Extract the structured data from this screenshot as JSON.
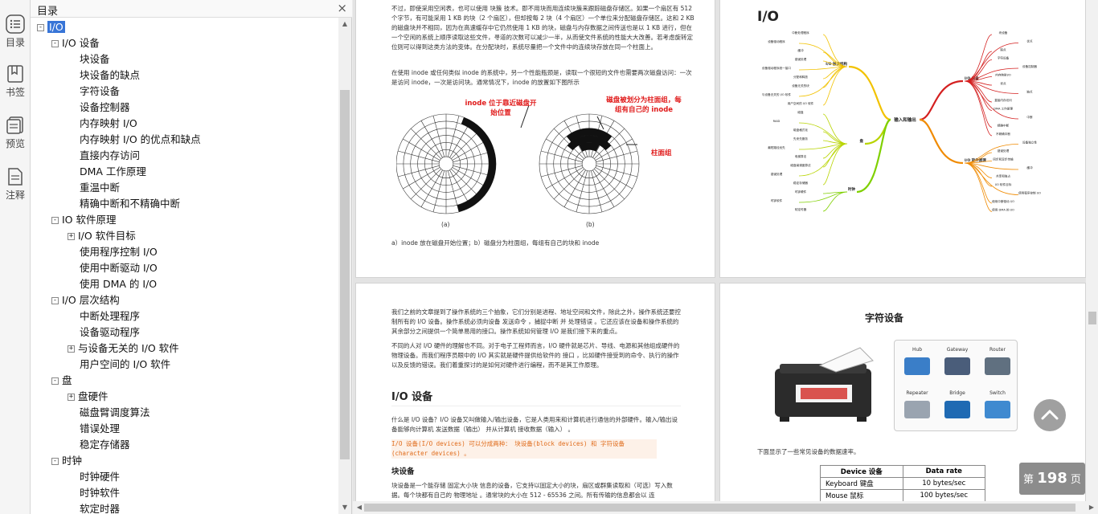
{
  "rail": [
    {
      "label": "目录",
      "icon": "list-icon"
    },
    {
      "label": "书签",
      "icon": "bookmark-icon"
    },
    {
      "label": "预览",
      "icon": "preview-icon"
    },
    {
      "label": "注释",
      "icon": "note-icon"
    }
  ],
  "toc": {
    "title": "目录",
    "close": "×",
    "items": [
      {
        "label": "I/O",
        "level": 0,
        "toggle": "-",
        "selected": true
      },
      {
        "label": "I/O 设备",
        "level": 1,
        "toggle": "-"
      },
      {
        "label": "块设备",
        "level": 2
      },
      {
        "label": "块设备的缺点",
        "level": 2
      },
      {
        "label": "字符设备",
        "level": 2
      },
      {
        "label": "设备控制器",
        "level": 2
      },
      {
        "label": "内存映射 I/O",
        "level": 2
      },
      {
        "label": "内存映射 I/O 的优点和缺点",
        "level": 2
      },
      {
        "label": "直接内存访问",
        "level": 2
      },
      {
        "label": "DMA 工作原理",
        "level": 2
      },
      {
        "label": "重温中断",
        "level": 2
      },
      {
        "label": "精确中断和不精确中断",
        "level": 2
      },
      {
        "label": "IO 软件原理",
        "level": 1,
        "toggle": "-"
      },
      {
        "label": "I/O 软件目标",
        "level": 2,
        "toggle": "+"
      },
      {
        "label": "使用程序控制 I/O",
        "level": 2
      },
      {
        "label": "使用中断驱动 I/O",
        "level": 2
      },
      {
        "label": "使用 DMA 的 I/O",
        "level": 2
      },
      {
        "label": "I/O 层次结构",
        "level": 1,
        "toggle": "-"
      },
      {
        "label": "中断处理程序",
        "level": 2
      },
      {
        "label": "设备驱动程序",
        "level": 2
      },
      {
        "label": "与设备无关的 I/O 软件",
        "level": 2,
        "toggle": "+"
      },
      {
        "label": "用户空间的 I/O 软件",
        "level": 2
      },
      {
        "label": "盘",
        "level": 1,
        "toggle": "-"
      },
      {
        "label": "盘硬件",
        "level": 2,
        "toggle": "+"
      },
      {
        "label": "磁盘臂调度算法",
        "level": 2
      },
      {
        "label": "错误处理",
        "level": 2
      },
      {
        "label": "稳定存储器",
        "level": 2
      },
      {
        "label": "时钟",
        "level": 1,
        "toggle": "-"
      },
      {
        "label": "时钟硬件",
        "level": 2
      },
      {
        "label": "时钟软件",
        "level": 2
      },
      {
        "label": "软定时器",
        "level": 2
      }
    ]
  },
  "page1": {
    "para1": "不过，即使采用空闲表，也可以使用 块簇 技术。即不用块而用连续块簇来跟踪磁盘存储区。如果一个扇区有 512 个字节，有可能采用 1 KB 的块（2 个扇区），但却按每 2 块（4 个扇区）一个单位来分配磁盘存储区。这和 2 KB 的磁盘块并不相同，因为在高速缓存中它仍然使用 1 KB 的块，磁盘与内存数据之间传送也是以 1 KB 进行，但在一个空闲的系统上顺序读取这些文件，寻道的次数可以减少一半，从而使文件系统的性能大大改善。若考虑旋转定位则可以得到这类方法的变体。在分配块时，系统尽量把一个文件中的连续块存放在同一个柱面上。",
    "para2": "在使用 inode 或任何类似 inode 的系统中，另一个性能瓶颈是，读取一个很短的文件也需要两次磁盘访问：一次是访问 inode，一次是访问块。通常情况下，inode 的放置如下图所示",
    "fig_label_a_title": "inode 位于靠近磁盘开始位置",
    "fig_label_b_title": "磁盘被划分为柱面组，每组有自己的 inode",
    "fig_label_cyl": "柱面组",
    "fig_a": "(a)",
    "fig_b": "(b)",
    "caption": "a）inode 放在磁盘开始位置；b）磁盘分为柱面组，每组有自己的块和 inode"
  },
  "page2": {
    "title": "I/O",
    "root": "输入和输出",
    "branches": [
      {
        "name": "I/O 层次结构",
        "color": "#f2c200"
      },
      {
        "name": "盘",
        "color": "#b8d400"
      },
      {
        "name": "时钟",
        "color": "#7fd000"
      },
      {
        "name": "I/O 设备",
        "color": "#d42020"
      },
      {
        "name": "I/O 软件原理",
        "color": "#f08a00"
      }
    ],
    "leaves_left": [
      "中断处理程序",
      "设备驱动程序",
      "缓冲",
      "错误处理",
      "设备驱动程序统一接口",
      "分配和释放",
      "设备无关的块",
      "与设备无关的 I/O 软件",
      "用户空间的 I/O 软件",
      "磁盘",
      "RAID",
      "磁盘格式化",
      "先来先服务",
      "最短路径优先",
      "电梯算法",
      "磁盘臂调度算法",
      "错误处理",
      "稳定存储器",
      "时钟硬件",
      "时钟软件",
      "软定时器"
    ],
    "leaves_right": [
      "块设备",
      "优点",
      "缺点",
      "字符设备",
      "设备控制器",
      "内存映射I/O",
      "优点",
      "缺点",
      "直接内存访问",
      "DMA 工作原理",
      "中断",
      "精确中断",
      "不精确中断",
      "设备独立性",
      "错误处理",
      "同步和异步传输",
      "缓冲",
      "共享和独占",
      "I/O 软件目标",
      "使用程序控制 I/O",
      "使用中断驱动 I/O",
      "使用 DMA 的 I/O"
    ]
  },
  "page3": {
    "para1": "我们之前的文章提到了操作系统的三个抽象，它们分别是进程、地址空间和文件，除此之外，操作系统还要控制所有的 I/O 设备。操作系统必须向设备 发送命令 ，捕捉中断 并 处理错误 。它还应该在设备和操作系统的其余部分之间提供一个简单易用的接口。操作系统如何管理 I/O 是我们接下来的重点。",
    "para2": "不同的人对 I/O 硬件的理解也不同。对于电子工程师而言，I/O 硬件就是芯片、导线、电源和其他组成硬件的物理设备。而我们程序员眼中的 I/O 其实就是硬件提供给软件的 接口 ，比如硬件接受到的命令、执行的操作以及反馈的错误。我们着重探讨的是如何对硬件进行编程，而不是其工作原理。",
    "heading": "I/O 设备",
    "para3": "什么是 I/O 设备？I/O 设备又叫做输入/输出设备，它是人类用来和计算机进行通信的外部硬件。输入/输出设备能够向计算机 发送数据（输出） 并从计算机 接收数据（输入） 。",
    "para4": "I/O 设备(I/O devices) 可以分成两种： 块设备(block devices) 和 字符设备(character devices) 。",
    "subheading": "块设备",
    "para5": "块设备是一个能存储 固定大小块 信息的设备，它支持以固定大小的块，扇区或群集读取和（可选）写入数据。每个块都有自己的 物理地址 。通常块的大小在 512 - 65536 之间。所有传输的信息都会以 连"
  },
  "page4": {
    "title": "字符设备",
    "devices": [
      "Hub",
      "Gateway",
      "Router",
      "Repeater",
      "Bridge",
      "Switch"
    ],
    "caption": "下面显示了一些常见设备的数据速率。",
    "table": {
      "headers": [
        "Device 设备",
        "Data rate"
      ],
      "rows": [
        [
          "Keyboard 键盘",
          "10 bytes/sec"
        ],
        [
          "Mouse 鼠标",
          "100 bytes/sec"
        ]
      ]
    }
  },
  "indicator": {
    "prefix": "第",
    "page": "198",
    "suffix": "页"
  }
}
